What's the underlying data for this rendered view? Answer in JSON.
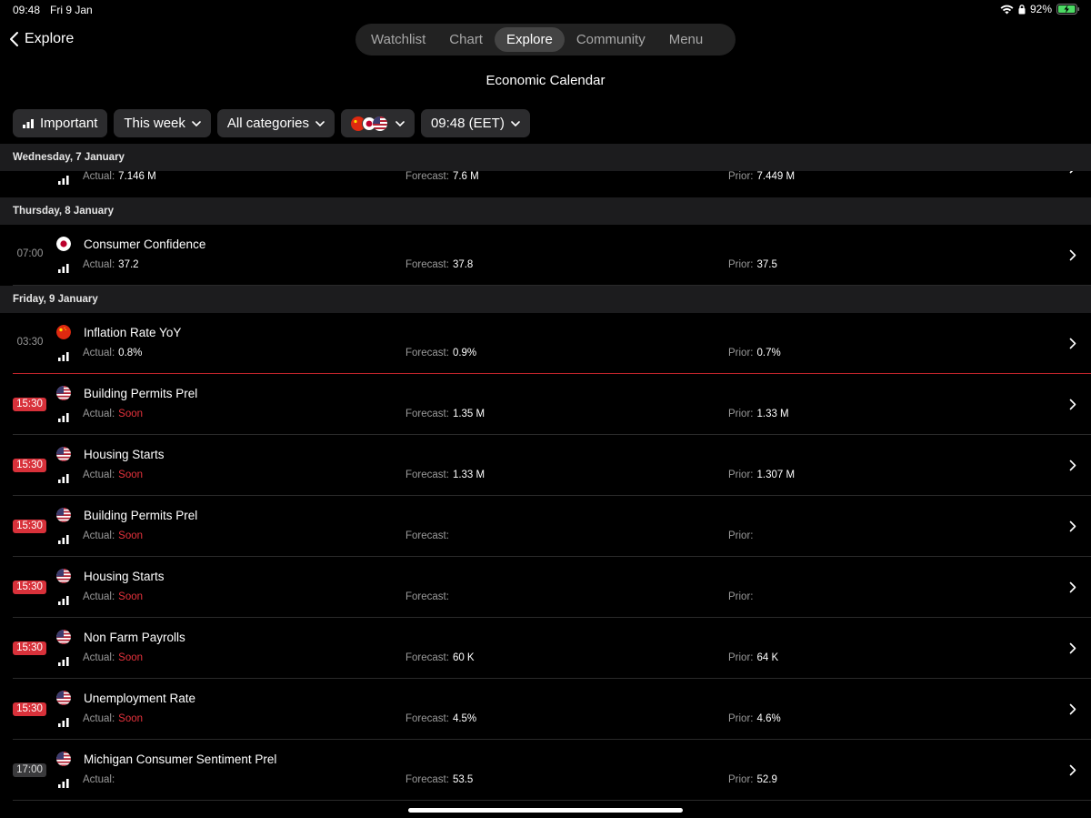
{
  "status": {
    "time": "09:48",
    "date": "Fri 9 Jan",
    "battery": "92%"
  },
  "nav": {
    "back_label": "Explore",
    "tabs": [
      {
        "label": "Watchlist",
        "active": false
      },
      {
        "label": "Chart",
        "active": false
      },
      {
        "label": "Explore",
        "active": true
      },
      {
        "label": "Community",
        "active": false
      },
      {
        "label": "Menu",
        "active": false
      }
    ]
  },
  "page_title": "Economic Calendar",
  "filters": {
    "importance": "Important",
    "period": "This week",
    "categories": "All categories",
    "timezone": "09:48 (EET)"
  },
  "days": [
    {
      "header": "Wednesday, 7 January",
      "events": [
        {
          "partial": true,
          "time": "",
          "time_style": "none",
          "flag": "",
          "title": "",
          "actual": "7.146 M",
          "forecast": "7.6 M",
          "prior": "7.449 M",
          "actual_soon": false
        }
      ]
    },
    {
      "header": "Thursday, 8 January",
      "events": [
        {
          "time": "07:00",
          "time_style": "plain",
          "flag": "jp",
          "title": "Consumer Confidence",
          "actual": "37.2",
          "forecast": "37.8",
          "prior": "37.5",
          "actual_soon": false
        }
      ]
    },
    {
      "header": "Friday, 9 January",
      "events": [
        {
          "time": "03:30",
          "time_style": "plain",
          "flag": "cn",
          "title": "Inflation Rate YoY",
          "actual": "0.8%",
          "forecast": "0.9%",
          "prior": "0.7%",
          "actual_soon": false
        },
        {
          "time": "15:30",
          "time_style": "soon",
          "flag": "us",
          "title": "Building Permits Prel",
          "actual": "Soon",
          "forecast": "1.35 M",
          "prior": "1.33 M",
          "actual_soon": true,
          "red_top": true
        },
        {
          "time": "15:30",
          "time_style": "soon",
          "flag": "us",
          "title": "Housing Starts",
          "actual": "Soon",
          "forecast": "1.33 M",
          "prior": "1.307 M",
          "actual_soon": true
        },
        {
          "time": "15:30",
          "time_style": "soon",
          "flag": "us",
          "title": "Building Permits Prel",
          "actual": "Soon",
          "forecast": "",
          "prior": "",
          "actual_soon": true
        },
        {
          "time": "15:30",
          "time_style": "soon",
          "flag": "us",
          "title": "Housing Starts",
          "actual": "Soon",
          "forecast": "",
          "prior": "",
          "actual_soon": true
        },
        {
          "time": "15:30",
          "time_style": "soon",
          "flag": "us",
          "title": "Non Farm Payrolls",
          "actual": "Soon",
          "forecast": "60 K",
          "prior": "64 K",
          "actual_soon": true
        },
        {
          "time": "15:30",
          "time_style": "soon",
          "flag": "us",
          "title": "Unemployment Rate",
          "actual": "Soon",
          "forecast": "4.5%",
          "prior": "4.6%",
          "actual_soon": true
        },
        {
          "time": "17:00",
          "time_style": "upcoming",
          "flag": "us",
          "title": "Michigan Consumer Sentiment Prel",
          "actual": "",
          "forecast": "53.5",
          "prior": "52.9",
          "actual_soon": false
        }
      ]
    }
  ],
  "labels": {
    "actual": "Actual:",
    "forecast": "Forecast:",
    "prior": "Prior:"
  },
  "colors": {
    "soon_red": "#e5323c",
    "background": "#000000",
    "header_bg": "#1c1c1e"
  }
}
